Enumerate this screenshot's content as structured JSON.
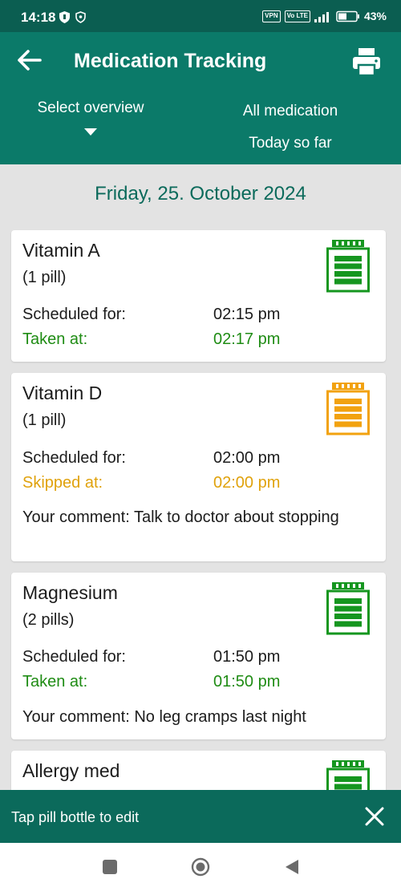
{
  "status_bar": {
    "time": "14:18",
    "vpn": "VPN",
    "volte": "Vo LTE",
    "battery": "43%"
  },
  "app_bar": {
    "title": "Medication Tracking",
    "overview_select": "Select overview",
    "filter_medication": "All medication",
    "filter_range": "Today so far",
    "color": "#0b7a69"
  },
  "date_heading": "Friday, 25. October 2024",
  "entries": [
    {
      "name": "Vitamin A",
      "dose": "(1 pill)",
      "scheduled_label": "Scheduled for:",
      "scheduled_time": "02:15 pm",
      "status_label": "Taken at:",
      "status_time": "02:17 pm",
      "status": "taken",
      "bottle_color": "#15961f"
    },
    {
      "name": "Vitamin D",
      "dose": "(1 pill)",
      "scheduled_label": "Scheduled for:",
      "scheduled_time": "02:00 pm",
      "status_label": "Skipped at:",
      "status_time": "02:00 pm",
      "status": "skipped",
      "bottle_color": "#f2a20f",
      "comment": "Your comment: Talk to doctor about stopping"
    },
    {
      "name": "Magnesium",
      "dose": "(2 pills)",
      "scheduled_label": "Scheduled for:",
      "scheduled_time": "01:50 pm",
      "status_label": "Taken at:",
      "status_time": "01:50 pm",
      "status": "taken",
      "bottle_color": "#15961f",
      "comment": "Your comment: No leg cramps last night"
    },
    {
      "name": "Allergy med",
      "status": "taken",
      "bottle_color": "#15961f"
    }
  ],
  "colors": {
    "taken": "#1f8c14",
    "skipped": "#e0a20c"
  },
  "snackbar": {
    "text": "Tap pill bottle to edit"
  }
}
